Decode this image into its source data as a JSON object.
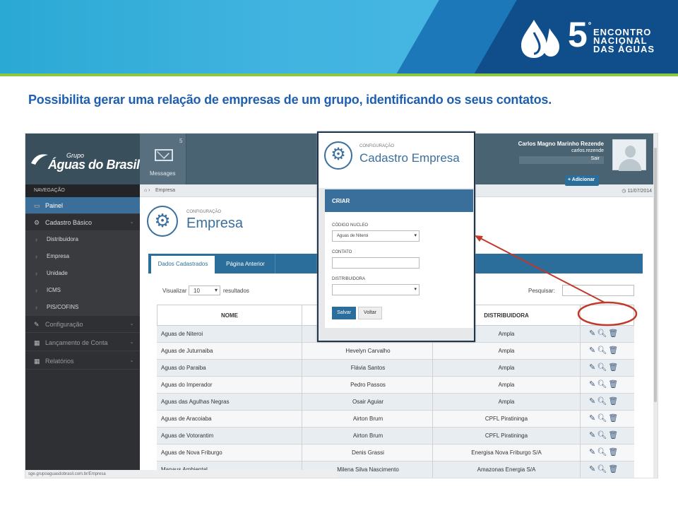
{
  "banner": {
    "five": "5",
    "ordinal": "º",
    "line1": "ENCONTRO",
    "line2": "NACIONAL",
    "line3": "DAS ÁGUAS"
  },
  "headline": "Possibilita gerar uma relação de empresas de um grupo, identificando os seus contatos.",
  "app": {
    "brand_group": "Grupo",
    "brand_name": "Águas do Brasil",
    "messages_label": "Messages",
    "messages_count": "5",
    "user_name": "Carlos Magno Marinho Rezende",
    "user_login": "carlos.rezende",
    "logout": "Sair",
    "nav_header": "NAVEGAÇÃO",
    "nav": [
      {
        "label": "Painel",
        "icon": "laptop-icon"
      },
      {
        "label": "Cadastro Básico",
        "icon": "gears-icon"
      },
      {
        "label": "Distribuidora"
      },
      {
        "label": "Empresa"
      },
      {
        "label": "Unidade"
      },
      {
        "label": "ICMS"
      },
      {
        "label": "PIS/COFINS"
      },
      {
        "label": "Configuração",
        "icon": "edit-icon"
      },
      {
        "label": "Lançamento de Conta",
        "icon": "calendar-icon"
      },
      {
        "label": "Relatórios",
        "icon": "calendar-icon"
      }
    ],
    "breadcrumb": "Empresa",
    "date": "11/07/2014",
    "page_small": "CONFIGURAÇÃO",
    "page_title": "Empresa",
    "tabs": [
      "Dados Cadastrados",
      "Página Anterior"
    ],
    "show_label": "Visualizar",
    "show_value": "10",
    "results_label": "resultados",
    "search_label": "Pesquisar:",
    "columns": [
      "NOME",
      "",
      "DISTRIBUIDORA"
    ],
    "add_label": "+ Adicionar",
    "rows": [
      [
        "Aguas de Niteroi",
        "",
        "Ampla"
      ],
      [
        "Aguas de Juturnaiba",
        "Hevelyn Carvalho",
        "Ampla"
      ],
      [
        "Aguas do Paraiba",
        "Flávia Santos",
        "Ampla"
      ],
      [
        "Aguas do Imperador",
        "Pedro Passos",
        "Ampla"
      ],
      [
        "Aguas das Agulhas Negras",
        "Osair Aguiar",
        "Ampla"
      ],
      [
        "Aguas de Aracoiaba",
        "Airton Brum",
        "CPFL Piratininga"
      ],
      [
        "Aguas de Votorantim",
        "Airton Brum",
        "CPFL Piratininga"
      ],
      [
        "Aguas de Nova Friburgo",
        "Denis Grassi",
        "Energisa Nova Friburgo S/A"
      ],
      [
        "Manaus Ambiental",
        "Milena Silva Nascimento",
        "Amazonas Energia S/A"
      ]
    ],
    "status_url": "sge.grupoaguasdobrasil.com.br/Empresa"
  },
  "modal": {
    "small": "CONFIGURAÇÃO",
    "title": "Cadastro Empresa",
    "section": "CRIAR",
    "nucleo_label": "CÓDIGO NUCLEO",
    "nucleo_value": "Aguas de Niteroi",
    "contato_label": "CONTATO",
    "distrib_label": "DISTRIBUIDORA",
    "save": "Salvar",
    "back": "Voltar"
  },
  "colors": {
    "accent": "#2b6e9b",
    "headline": "#1f5fb1",
    "callout": "#c0392b"
  }
}
